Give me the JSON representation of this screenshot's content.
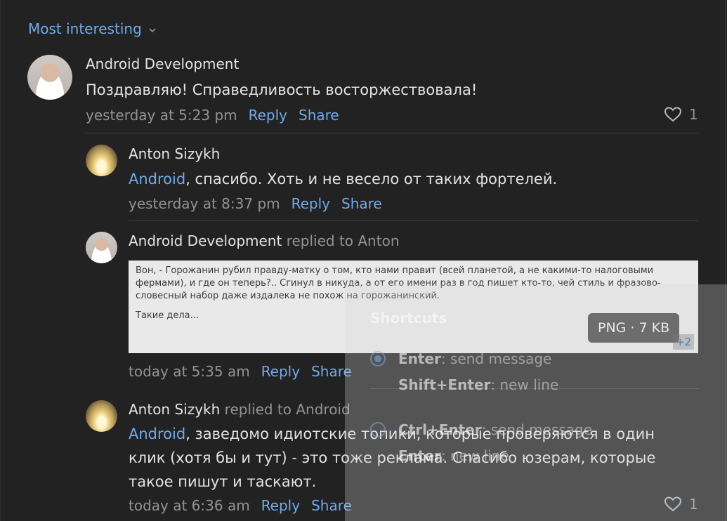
{
  "sort": {
    "label": "Most interesting"
  },
  "comments": [
    {
      "author": "Android Development",
      "text": "Поздравляю! Справедливость восторжествовала!",
      "time": "yesterday at 5:23 pm",
      "reply": "Reply",
      "share": "Share",
      "likes": "1"
    },
    {
      "author": "Anton Sizykh",
      "mention": "Android",
      "text": ", спасибо. Хоть и не весело от таких фортелей.",
      "time": "yesterday at 8:37 pm",
      "reply": "Reply",
      "share": "Share"
    },
    {
      "author": "Android Development",
      "replied_to": "replied to Anton",
      "attachment": {
        "line1": "Вон, - Горожанин рубил правду-матку о том, кто нами правит (всей планетой, а не какими-то налоговыми фермами), и где он теперь?.. Сгинул в никуда, а от его имени раз в год пишет кто-то, чей стиль и фразово-словесный набор даже издалека не похож на горожанинский.",
        "line2": "Такие дела...",
        "badge": "PNG · 7 KB",
        "more": "+2"
      },
      "time": "today at 5:35 am",
      "reply": "Reply",
      "share": "Share"
    },
    {
      "author": "Anton Sizykh",
      "replied_to": "replied to Android",
      "mention": "Android",
      "text": ", заведомо идиотские топики, которые проверяются в один клик (хотя бы и тут) - это тоже реклама. Спасибо юзерам, которые такое пишут и таскают.",
      "time": "today at 6:36 am",
      "reply": "Reply",
      "share": "Share",
      "likes": "1"
    }
  ],
  "shortcuts": {
    "title": "Shortcuts",
    "option1_key": "Enter",
    "option1_desc": ": send message",
    "option1_sub_key": "Shift+Enter",
    "option1_sub_desc": ": new line",
    "option2_key": "Ctrl+Enter",
    "option2_desc": ": send message",
    "option2_sub_key": "Enter",
    "option2_sub_desc": ": new line"
  }
}
